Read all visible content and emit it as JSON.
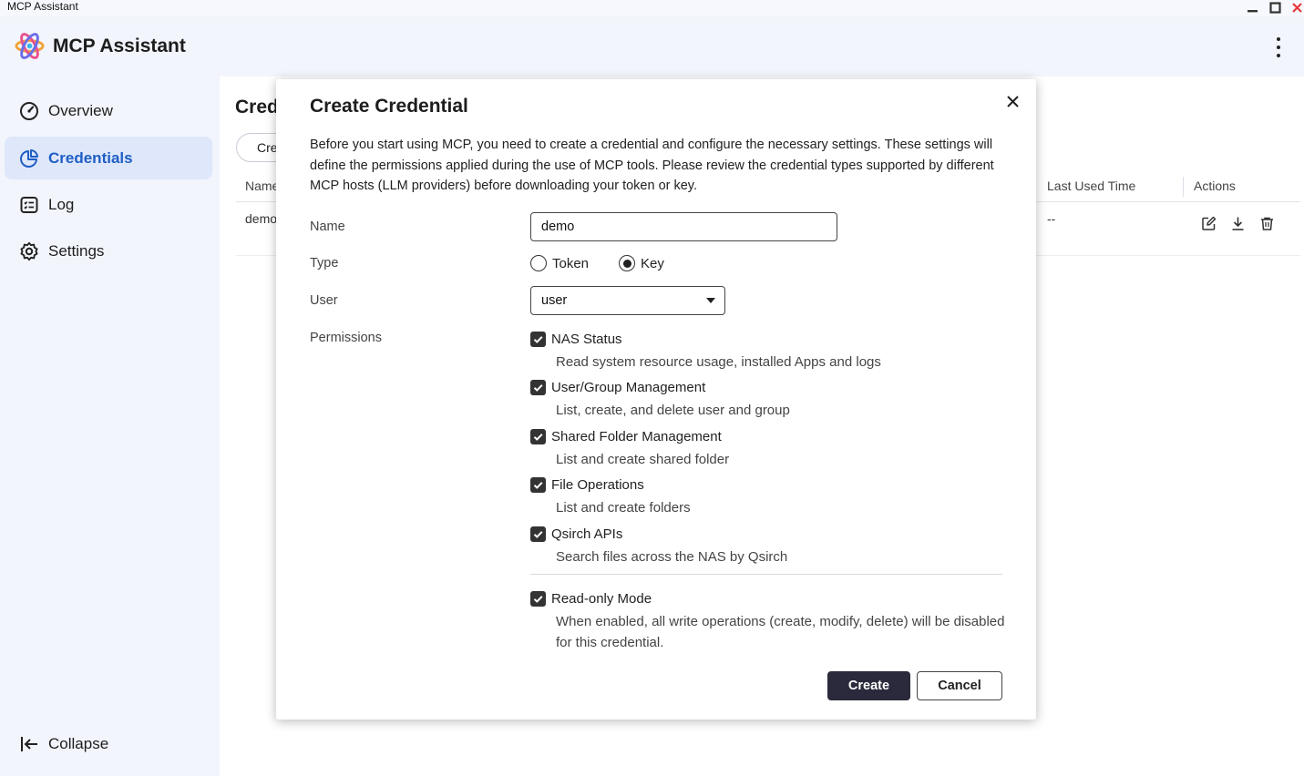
{
  "window": {
    "title": "MCP Assistant"
  },
  "app": {
    "title": "MCP Assistant"
  },
  "colors": {
    "accent": "#1f5fc4",
    "active_bg": "#dfe7fb",
    "primary_button": "#2a2a3c",
    "close_red": "#e8383d"
  },
  "sidebar": {
    "items": [
      {
        "label": "Overview",
        "icon": "speedometer-icon"
      },
      {
        "label": "Credentials",
        "icon": "pie-chart-icon",
        "active": true
      },
      {
        "label": "Log",
        "icon": "log-list-icon"
      },
      {
        "label": "Settings",
        "icon": "gear-icon"
      }
    ],
    "collapse_label": "Collapse"
  },
  "main": {
    "title": "Cred",
    "create_button": "Cre",
    "table": {
      "columns": [
        "Name",
        "Last Used Time",
        "Actions"
      ],
      "rows": [
        {
          "name": "demo",
          "last_used": "--"
        }
      ]
    }
  },
  "dialog": {
    "title": "Create Credential",
    "description": "Before you start using MCP, you need to create a credential and configure the necessary settings. These settings will define the permissions applied during the use of MCP tools. Please review the credential types supported by different MCP hosts (LLM providers) before downloading your token or key.",
    "name_label": "Name",
    "name_value": "demo",
    "type_label": "Type",
    "type_options": [
      "Token",
      "Key"
    ],
    "type_selected": "Key",
    "user_label": "User",
    "user_value": "user",
    "permissions_label": "Permissions",
    "permissions": [
      {
        "title": "NAS Status",
        "desc": "Read system resource usage, installed Apps and logs",
        "checked": true
      },
      {
        "title": "User/Group Management",
        "desc": "List, create, and delete user and group",
        "checked": true
      },
      {
        "title": "Shared Folder Management",
        "desc": "List and create shared folder",
        "checked": true
      },
      {
        "title": "File Operations",
        "desc": "List and create folders",
        "checked": true
      },
      {
        "title": "Qsirch APIs",
        "desc": "Search files across the NAS by Qsirch",
        "checked": true
      }
    ],
    "readonly": {
      "title": "Read-only Mode",
      "desc": "When enabled, all write operations (create, modify, delete) will be disabled for this credential.",
      "checked": true
    },
    "create_button": "Create",
    "cancel_button": "Cancel"
  }
}
